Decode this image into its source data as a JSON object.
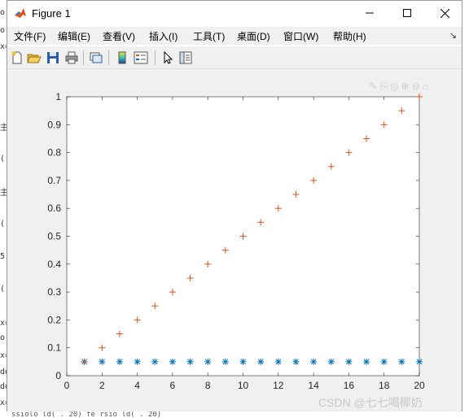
{
  "window": {
    "title": "Figure 1"
  },
  "menu": {
    "items": [
      "文件(F)",
      "编辑(E)",
      "查看(V)",
      "插入(I)",
      "工具(T)",
      "桌面(D)",
      "窗口(W)",
      "帮助(H)"
    ],
    "dock_glyph": "↘"
  },
  "toolbar": {
    "buttons": [
      "new-figure-icon",
      "open-file-icon",
      "save-icon",
      "print-icon",
      "link-plot-icon",
      "colorbar-icon",
      "legend-icon",
      "pointer-icon",
      "property-inspector-icon"
    ]
  },
  "axes_toolbar": {
    "glyphs": "✎⎘◎⊕⊖⌂"
  },
  "watermark": "CSDN @七七喝椰奶",
  "background_fragments": [
    "o",
    "o",
    "x=",
    "主",
    "(",
    "主",
    "(",
    "5",
    "(",
    "x=",
    "o",
    "x=",
    "dd",
    "dd",
    "x="
  ],
  "background_bottom": "ssiolo ld( .  20) fe rsio ld( .  20)",
  "chart_data": {
    "type": "scatter",
    "title": "",
    "xlabel": "",
    "ylabel": "",
    "xlim": [
      0,
      20
    ],
    "ylim": [
      0,
      1
    ],
    "xticks": [
      "0",
      "2",
      "4",
      "6",
      "8",
      "10",
      "12",
      "14",
      "16",
      "18",
      "20"
    ],
    "yticks": [
      "0",
      "0.1",
      "0.2",
      "0.3",
      "0.4",
      "0.5",
      "0.6",
      "0.7",
      "0.8",
      "0.9",
      "1"
    ],
    "grid": false,
    "series": [
      {
        "marker": "*",
        "color": "#0072BD",
        "x": [
          1,
          2,
          3,
          4,
          5,
          6,
          7,
          8,
          9,
          10,
          11,
          12,
          13,
          14,
          15,
          16,
          17,
          18,
          19,
          20
        ],
        "y": [
          0.05,
          0.05,
          0.05,
          0.05,
          0.05,
          0.05,
          0.05,
          0.05,
          0.05,
          0.05,
          0.05,
          0.05,
          0.05,
          0.05,
          0.05,
          0.05,
          0.05,
          0.05,
          0.05,
          0.05
        ]
      },
      {
        "marker": "+",
        "color": "#D95319",
        "x": [
          1,
          2,
          3,
          4,
          5,
          6,
          7,
          8,
          9,
          10,
          11,
          12,
          13,
          14,
          15,
          16,
          17,
          18,
          19,
          20
        ],
        "y": [
          0.05,
          0.1,
          0.15,
          0.2,
          0.25,
          0.3,
          0.35,
          0.4,
          0.45,
          0.5,
          0.55,
          0.6,
          0.65,
          0.7,
          0.75,
          0.8,
          0.85,
          0.9,
          0.95,
          1.0
        ]
      }
    ]
  }
}
